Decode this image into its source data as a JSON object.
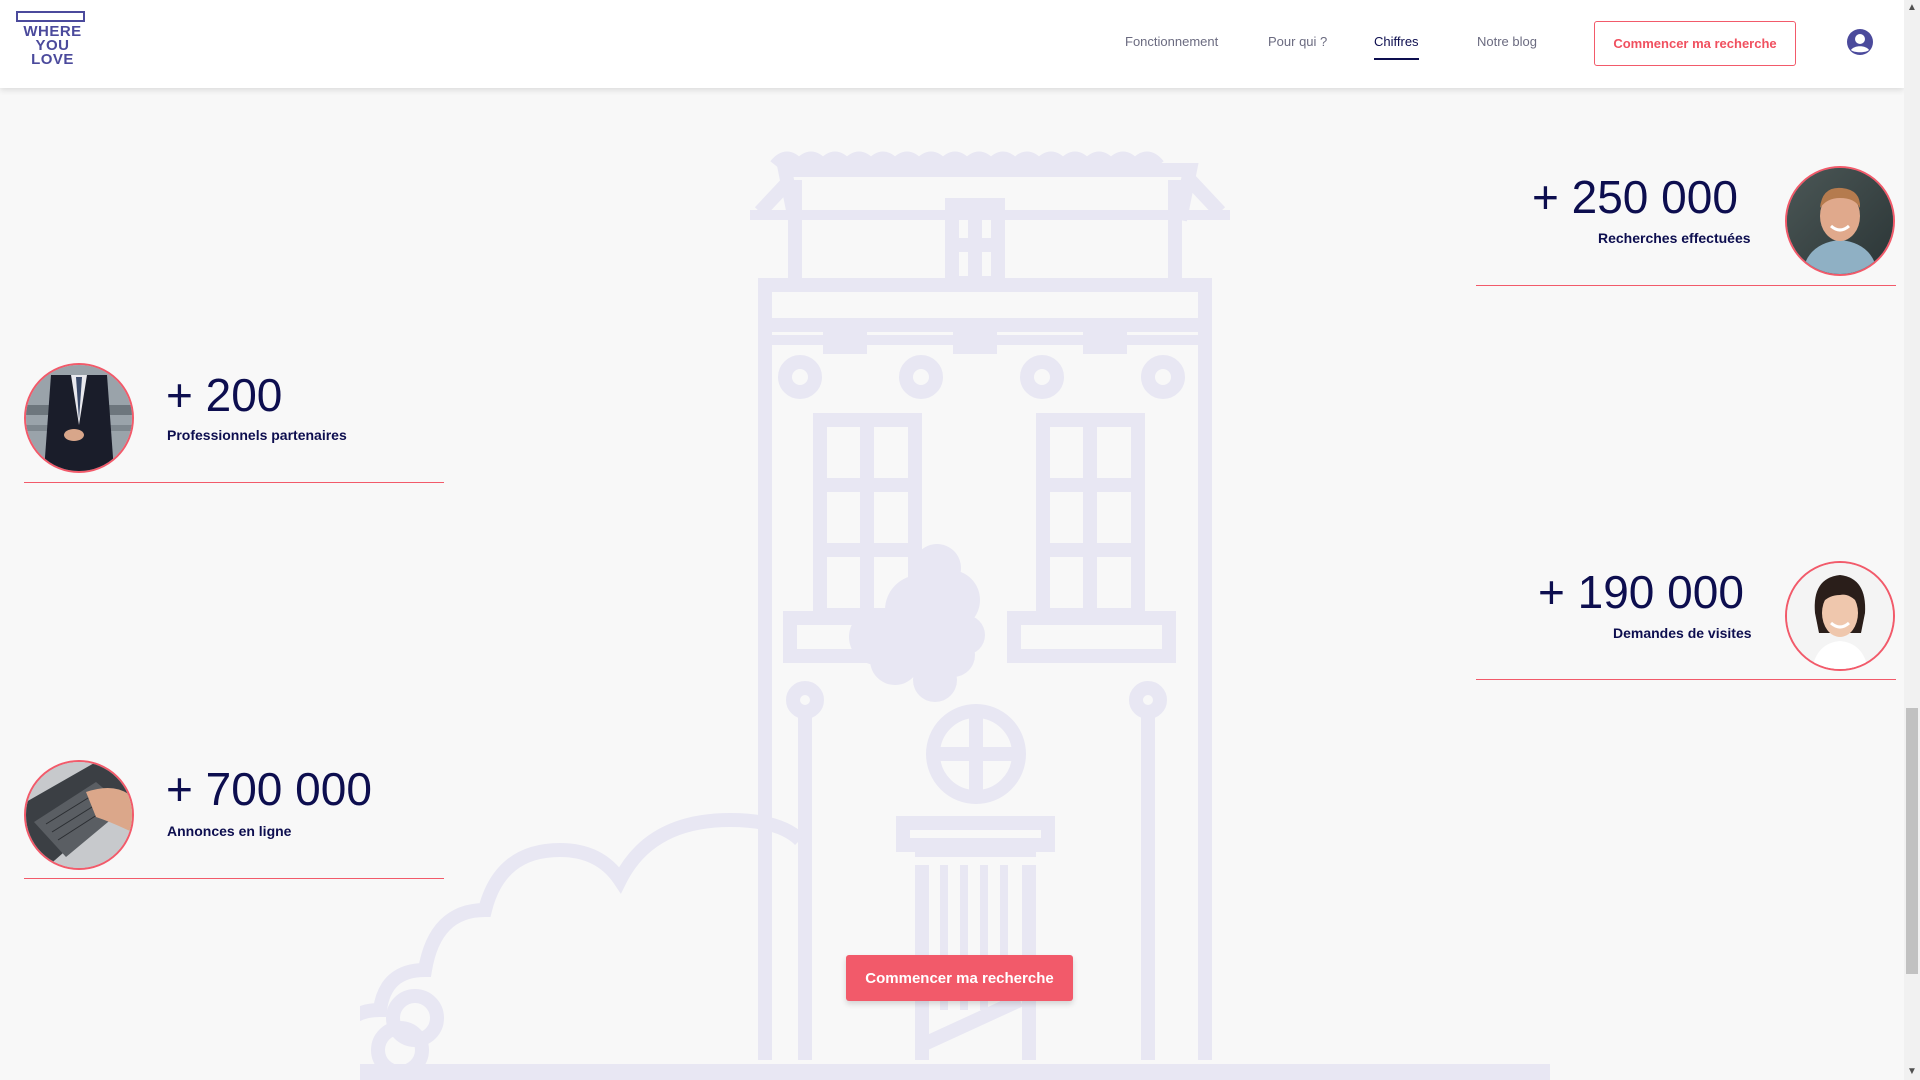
{
  "brand": {
    "logo_lines": [
      "WHERE",
      "YOU",
      "LOVE"
    ]
  },
  "nav": {
    "items": [
      {
        "label": "Fonctionnement",
        "active": false
      },
      {
        "label": "Pour qui ?",
        "active": false
      },
      {
        "label": "Chiffres",
        "active": true
      },
      {
        "label": "Notre blog",
        "active": false
      }
    ],
    "cta_label": "Commencer ma recherche",
    "user_icon": "user-circle-icon"
  },
  "stats": [
    {
      "value": "+ 250 000",
      "label": "Recherches effectuées",
      "avatar": "young-man-denim-jacket"
    },
    {
      "value": "+ 200",
      "label": "Professionnels partenaires",
      "avatar": "businessman-suit"
    },
    {
      "value": "+ 190 000",
      "label": "Demandes de visites",
      "avatar": "smiling-woman"
    },
    {
      "value": "+ 700 000",
      "label": "Annonces en ligne",
      "avatar": "hands-on-laptop"
    }
  ],
  "main_cta": {
    "label": "Commencer ma recherche"
  },
  "colors": {
    "primary": "#0d0e4f",
    "accent": "#f25a6a",
    "logo": "#4b4a9c",
    "illustration": "#e8e7f3",
    "background": "#f8f8f8"
  }
}
